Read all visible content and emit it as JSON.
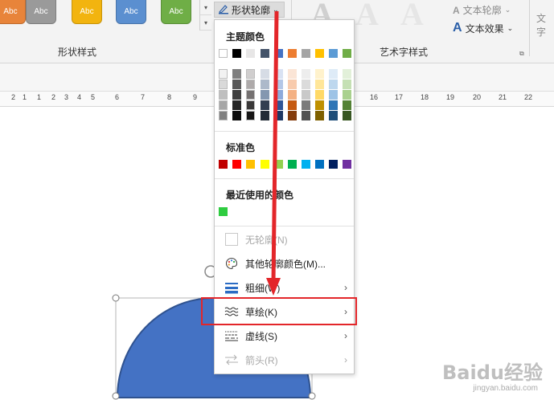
{
  "ribbon": {
    "style_buttons": [
      {
        "label": "Abc",
        "color": "#e8843a"
      },
      {
        "label": "Abc",
        "color": "#9a9a9a"
      },
      {
        "label": "Abc",
        "color": "#f2b40f"
      },
      {
        "label": "Abc",
        "color": "#5b8fd0"
      },
      {
        "label": "Abc",
        "color": "#6fae46"
      }
    ],
    "shape_styles_label": "形状样式",
    "shape_outline_label": "形状轮廓",
    "wordart_label": "艺术字样式",
    "text_outline_label": "文本轮廓",
    "text_effect_label": "文本效果",
    "text_partial_label": "文字"
  },
  "ruler": {
    "numbers": [
      "2",
      "1",
      "1",
      "2",
      "3",
      "4",
      "5",
      "6",
      "7",
      "8",
      "9",
      "16",
      "17",
      "18",
      "19",
      "20",
      "21",
      "22"
    ]
  },
  "dropdown": {
    "theme_colors_title": "主题颜色",
    "theme_top_row": [
      "#ffffff",
      "#000000",
      "#e7e6e6",
      "#44546a",
      "#4472c4",
      "#ed7d31",
      "#a5a5a5",
      "#ffc000",
      "#5b9bd5",
      "#70ad47"
    ],
    "theme_shades": [
      [
        "#f2f2f2",
        "#d9d9d9",
        "#bfbfbf",
        "#a6a6a6",
        "#808080"
      ],
      [
        "#7f7f7f",
        "#595959",
        "#404040",
        "#262626",
        "#0d0d0d"
      ],
      [
        "#d0cece",
        "#aeaaaa",
        "#757171",
        "#3a3838",
        "#171616"
      ],
      [
        "#d6dce5",
        "#adb9ca",
        "#8497b0",
        "#333f50",
        "#222a35"
      ],
      [
        "#d9e2f3",
        "#b4c7e7",
        "#8eaadb",
        "#2f5597",
        "#1f3864"
      ],
      [
        "#fbe5d6",
        "#f8cbad",
        "#f4b183",
        "#c55a11",
        "#843c0c"
      ],
      [
        "#ededed",
        "#dbdbdb",
        "#c9c9c9",
        "#7b7b7b",
        "#525252"
      ],
      [
        "#fff2cc",
        "#ffe699",
        "#ffd966",
        "#bf9000",
        "#7f6000"
      ],
      [
        "#deebf7",
        "#bdd7ee",
        "#9dc3e6",
        "#2e75b6",
        "#1f4e79"
      ],
      [
        "#e2f0d9",
        "#c5e0b4",
        "#a9d18e",
        "#548235",
        "#385723"
      ]
    ],
    "standard_colors_title": "标准色",
    "standard_colors": [
      "#c00000",
      "#ff0000",
      "#ffc000",
      "#ffff00",
      "#92d050",
      "#00b050",
      "#00b0f0",
      "#0070c0",
      "#002060",
      "#7030a0"
    ],
    "recent_colors_title": "最近使用的颜色",
    "recent_colors": [
      "#2ecc40"
    ],
    "items": {
      "no_outline": "无轮廓(N)",
      "more_colors": "其他轮廓颜色(M)...",
      "weight": "粗细(W)",
      "sketch": "草绘(K)",
      "dashes": "虚线(S)",
      "arrows": "箭头(R)"
    }
  },
  "watermark": {
    "brand": "Baidu经验",
    "url": "jingyan.baidu.com"
  },
  "colors": {
    "shape_fill": "#4472c4",
    "highlight": "#e3262a",
    "arrow": "#e3262a"
  }
}
